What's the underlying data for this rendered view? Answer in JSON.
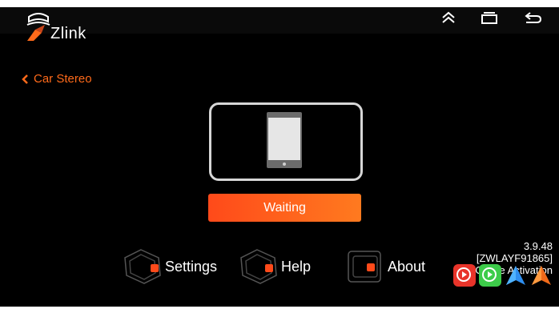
{
  "app": {
    "logo_text": "Zlink"
  },
  "nav": {
    "back_label": "Car Stereo"
  },
  "status": {
    "button_label": "Waiting"
  },
  "menu": {
    "settings_label": "Settings",
    "help_label": "Help",
    "about_label": "About"
  },
  "version": {
    "number": "3.9.48",
    "code": "[ZWLAYF91865]",
    "activation": "Offline Activation"
  },
  "icons": {
    "collapse": "double-chevron-up-icon",
    "recents": "recent-apps-icon",
    "back": "back-arrow-icon",
    "connection_apps": [
      "carplay-red-icon",
      "carplay-green-icon",
      "android-auto-blue-icon",
      "android-auto-orange-icon"
    ]
  },
  "colors": {
    "accent": "#ff6a1a",
    "button": "#ff5a1f",
    "frame": "#d6d6d6"
  }
}
